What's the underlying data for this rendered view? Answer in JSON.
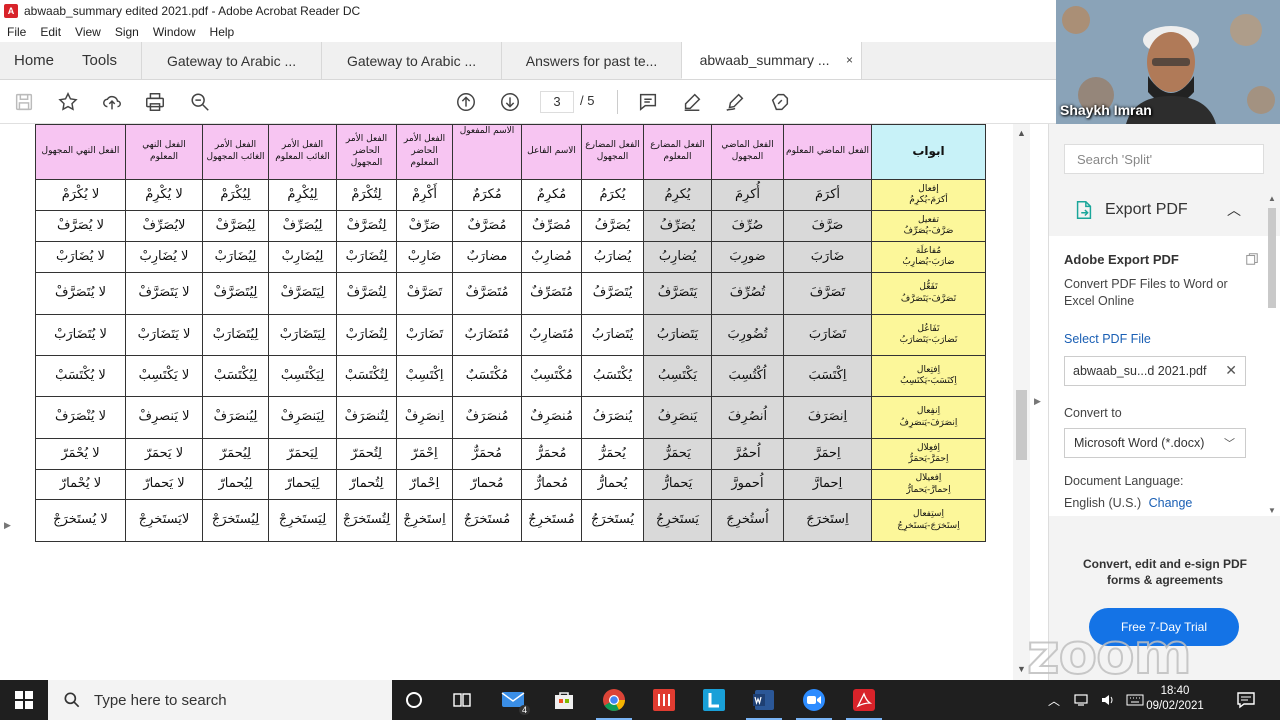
{
  "window": {
    "title": "abwaab_summary edited 2021.pdf - Adobe Acrobat Reader DC",
    "app_icon_label": "A"
  },
  "menu": [
    "File",
    "Edit",
    "View",
    "Sign",
    "Window",
    "Help"
  ],
  "nav_tabs": [
    "Home",
    "Tools"
  ],
  "doc_tabs": [
    {
      "label": "Gateway to Arabic ..."
    },
    {
      "label": "Gateway to Arabic ..."
    },
    {
      "label": "Answers for past te..."
    },
    {
      "label": "abwaab_summary ...",
      "close": "×"
    }
  ],
  "toolbar": {
    "page_current": "3",
    "page_total": "/ 5"
  },
  "table": {
    "headers": [
      "الفعل النهي المجهول",
      "الفعل النهي المعلوم",
      "الفعل الأمر الغائب المجهول",
      "الفعل الأمر الغائب المعلوم",
      "الفعل الأمر الحاضر المجهول",
      "الفعل الأمر الحاضر المعلوم",
      "الاسم المفعول",
      "الاسم الفاعل",
      "الفعل المضارع المجهول",
      "الفعل المضارع المعلوم",
      "الفعل الماضي المجهول",
      "الفعل الماضي المعلوم",
      "ابواب"
    ],
    "rows": [
      [
        "لا يُكْرَمْ",
        "لا يُكْرِمْ",
        "لِيُكْرَمْ",
        "لِيُكْرِمْ",
        "لِتُكْرَمْ",
        "أَكْرِمْ",
        "مُكرَمٌ",
        "مُكرِمٌ",
        "يُكرَمُ",
        "يُكرِمُ",
        "أُكرِمَ",
        "أكرَمَ",
        "إفعال\nأكرَمَ-يُكرِمُ"
      ],
      [
        "لا يُصَرَّفْ",
        "لايُصَرِّفْ",
        "لِيُصَرَّفْ",
        "لِيُصَرِّفْ",
        "لِتُصَرَّفْ",
        "صَرِّفْ",
        "مُصَرَّفٌ",
        "مُصَرِّفٌ",
        "يُصَرَّفُ",
        "يُصَرِّفُ",
        "صُرِّفَ",
        "صَرَّفَ",
        "تفعيل\nصَرَّفَ-يُصَرِّفُ"
      ],
      [
        "لا يُضَارَبْ",
        "لا يُضَارِبْ",
        "لِيُضَارَبْ",
        "لِيُضَارِبْ",
        "لِتُضَارَبْ",
        "ضَارِبْ",
        "مضارَبٌ",
        "مُضارِبٌ",
        "يُضارَبُ",
        "يُضارِبُ",
        "ضورِبَ",
        "ضَارَبَ",
        "مُفاعلَة\nضارَبَ-يُضارِبُ"
      ],
      [
        "لا يُتَصَرَّفْ",
        "لا يَتَصَرَّفْ",
        "لِيُتَصَرَّفْ",
        "لِيَتَصَرَّفْ",
        "لِتُصَرَّفْ",
        "تَصَرَّفْ",
        "مُتَصَرَّفٌ",
        "مُتَصَرِّفٌ",
        "يُتَصَرَّفُ",
        "يَتَصَرَّفُ",
        "تُصُرِّفَ",
        "تَصَرَّفَ",
        "تَفَعُّل\nتَصَرَّفَ-يَتَصَرَّفُ"
      ],
      [
        "لا يُتَضَارَبْ",
        "لا يَتَضَارَبْ",
        "لِيُتَضَارَبْ",
        "لِيَتَضَارَبْ",
        "لِتُضَارَبْ",
        "تَضَارَبْ",
        "مُتَضَارَبٌ",
        "مُتَضارِبٌ",
        "يُتَضارَبُ",
        "يَتَضارَبُ",
        "تُضُورِبَ",
        "تَضَارَبَ",
        "تَفَاعُل\nتَضارَبَ-يَتَضارَبُ"
      ],
      [
        "لا يُكْتَسَبْ",
        "لا يَكْتَسِبْ",
        "لِيُكْتَسَبْ",
        "لِيَكْتَسِبْ",
        "لِتُكْتَسَبْ",
        "اِكْتَسِبْ",
        "مُكْتَسَبٌ",
        "مُكْتَسِبٌ",
        "يُكْتَسَبُ",
        "يَكْتَسِبُ",
        "اُكْتُسِبَ",
        "اِكْتَسَبَ",
        "اِفتِعال\nاِكتَسَبَ-يَكتَسِبُ"
      ],
      [
        "لا يُنْصَرَفْ",
        "لا يَنصرِفْ",
        "لِيُنصَرَفْ",
        "لِيَنصَرِفْ",
        "لِتُنصَرَفْ",
        "اِنصَرِفْ",
        "مُنصَرَفٌ",
        "مُنصَرِفٌ",
        "يُنصَرَفُ",
        "يَنصَرِفُ",
        "اُنصُرِفَ",
        "اِنصَرَفَ",
        "اِنفِعال\nاِنصَرَفَ-يَنصَرِفُ"
      ],
      [
        "لا يُحْمَرّ",
        "لا يَحمَرّ",
        "لِيُحمَرّ",
        "لِيَحمَرّ",
        "لِتُحمَرّ",
        "اِحْمَرّ",
        "مُحمَرٌّ",
        "مُحمَرٌّ",
        "يُحمَرُّ",
        "يَحمَرُّ",
        "اُحمُرَّ",
        "اِحمَرَّ",
        "اِفعِلال\nاِحمَرَّ-يَحمَرُّ"
      ],
      [
        "لا يُحْمارّ",
        "لا يَحمارّ",
        "لِيُحمارّ",
        "لِيَحمارّ",
        "لِتُحمارّ",
        "اِحْمارّ",
        "مُحمارّ",
        "مُحمارٌّ",
        "يُحمارُّ",
        "يَحمارُّ",
        "اُحمورَّ",
        "اِحمارَّ",
        "اِفعيلال\nاِحمارَّ-يَحمارُّ"
      ],
      [
        "لا يُستَخرَجْ",
        "لايَستَخرِجْ",
        "لِيُستَخرَجْ",
        "لِيَستَخرِجْ",
        "لِتُستَخرَجْ",
        "اِستَخرِجْ",
        "مُستَخرَجٌ",
        "مُستَخرِجٌ",
        "يُستَخرَجُ",
        "يَستَخرِجُ",
        "اُستُخرِجَ",
        "اِستَخرَجَ",
        "اِستِفعال\nاِستَخرَجَ-يَستَخرِجُ"
      ]
    ]
  },
  "side_panel": {
    "search_placeholder": "Search 'Split'",
    "export_label": "Export PDF",
    "aep_title": "Adobe Export PDF",
    "aep_desc": "Convert PDF Files to Word or Excel Online",
    "select_pdf": "Select PDF File",
    "selected_file": "abwaab_su...d 2021.pdf",
    "convert_to": "Convert to",
    "format": "Microsoft Word (*.docx)",
    "doc_language": "Document Language:",
    "language": "English (U.S.)",
    "change": "Change",
    "promo": "Convert, edit and e-sign PDF forms & agreements",
    "trial": "Free 7-Day Trial",
    "watermark": "zoom"
  },
  "webcam": {
    "name": "Shaykh Imran"
  },
  "taskbar": {
    "search_placeholder": "Type here to search",
    "mail_badge": "4",
    "time": "18:40",
    "date": "09/02/2021"
  },
  "colors": {
    "header_pink": "#f7c5f2",
    "header_cyan": "#c8f2f8",
    "abwab_yellow": "#fcf79a",
    "cell_gray": "#d9d9d9",
    "accent_blue": "#1473e6"
  }
}
